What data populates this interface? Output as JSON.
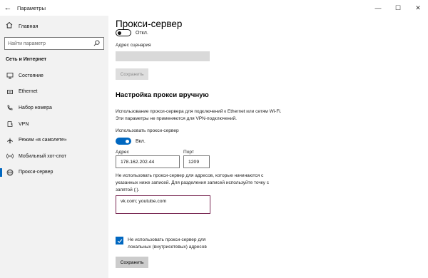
{
  "window": {
    "app_title": "Параметры",
    "controls": [
      "—",
      "☐",
      "✕"
    ]
  },
  "sidebar": {
    "home_label": "Главная",
    "search_placeholder": "Найти параметр",
    "section_title": "Сеть и Интернет",
    "items": [
      {
        "label": "Состояние",
        "icon": "status-icon"
      },
      {
        "label": "Ethernet",
        "icon": "ethernet-icon"
      },
      {
        "label": "Набор номера",
        "icon": "dialup-icon"
      },
      {
        "label": "VPN",
        "icon": "vpn-icon"
      },
      {
        "label": "Режим «в самолете»",
        "icon": "airplane-icon"
      },
      {
        "label": "Мобильный хот-спот",
        "icon": "hotspot-icon"
      },
      {
        "label": "Прокси-сервер",
        "icon": "globe-icon",
        "active": true
      }
    ]
  },
  "main": {
    "page_title": "Прокси-сервер",
    "auto_toggle_state": "Откл.",
    "script_address_label": "Адрес сценария",
    "save_disabled_label": "Сохранить",
    "manual_heading": "Настройка прокси вручную",
    "manual_description": "Использование прокси-сервера для подключений к Ethernet или сетям Wi-Fi. Эти параметры не применяются для VPN-подключений.",
    "use_proxy_label": "Использовать прокси-сервер",
    "use_proxy_state": "Вкл.",
    "address_label": "Адрес",
    "address_value": "178.162.202.44",
    "port_label": "Порт",
    "port_value": "1209",
    "exceptions_description": "Не использовать прокси-сервер для адресов, которые начинаются с указанных ниже записей. Для разделения записей используйте точку с запятой (;).",
    "exceptions_value": "vk.com; youtube.com",
    "local_bypass_label": "Не использовать прокси-сервер для локальных (внутрисетевых) адресов",
    "local_bypass_checked": true,
    "save_label": "Сохранить"
  },
  "colors": {
    "accent": "#0067c0",
    "sidebar_bg": "#f2f2f2",
    "button_bg": "#cccccc"
  }
}
